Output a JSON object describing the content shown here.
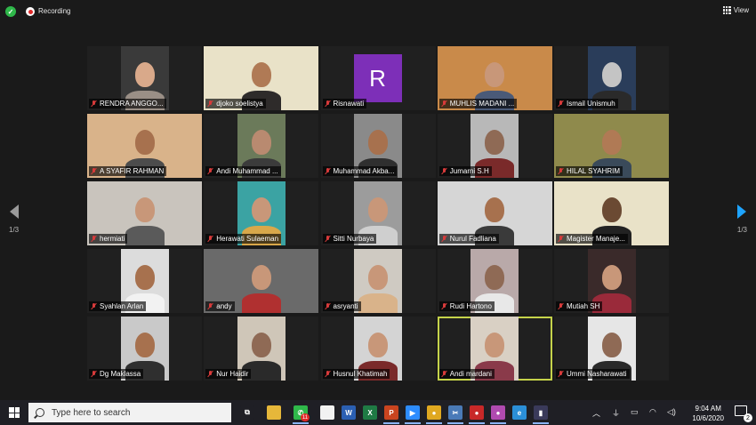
{
  "topbar": {
    "recording_label": "Recording",
    "view_label": "View"
  },
  "nav": {
    "page_left": "1/3",
    "page_right": "1/3"
  },
  "participants": [
    {
      "name": "RENDRA ANGGO...",
      "bg": "#3a3a3a",
      "skin": "#d9a98a",
      "cloth": "#9a8f86",
      "video": "narrow"
    },
    {
      "name": "djoko soelistya",
      "bg": "#e9e2c8",
      "skin": "#b07a55",
      "cloth": "#2e2b2a",
      "video": "wide"
    },
    {
      "name": "Risnawati",
      "bg": "#1b1b1b",
      "video": "avatar",
      "initial": "R"
    },
    {
      "name": "MUHLIS MADANI ...",
      "bg": "#c98a4a",
      "skin": "#c89779",
      "cloth": "#4a5a78",
      "video": "wide"
    },
    {
      "name": "Ismail Unismuh",
      "bg": "#2a3d5a",
      "skin": "#c4c4c4",
      "cloth": "#2a2a2a",
      "video": "narrow"
    },
    {
      "name": "A SYAFIR RAHMAN",
      "bg": "#d9b38a",
      "skin": "#a7714e",
      "cloth": "#4c4c4c",
      "video": "wide"
    },
    {
      "name": "Andi Muhammad ...",
      "bg": "#6b7a5a",
      "skin": "#b98a70",
      "cloth": "#3b3b3b",
      "video": "narrow"
    },
    {
      "name": "Muhammad Akba...",
      "bg": "#8a8a8a",
      "skin": "#a7714e",
      "cloth": "#2f2f2f",
      "video": "narrow"
    },
    {
      "name": "Jumarni S.H",
      "bg": "#b8b8b8",
      "skin": "#8f6a55",
      "cloth": "#7a2a2a",
      "video": "narrow"
    },
    {
      "name": "HILAL SYAHRIM",
      "bg": "#8f8a4c",
      "skin": "#b07a55",
      "cloth": "#3a4a5a",
      "video": "wide"
    },
    {
      "name": "hermiati",
      "bg": "#c9c4bd",
      "skin": "#c89779",
      "cloth": "#5a5a5a",
      "video": "wide"
    },
    {
      "name": "Herawati Sulaeman",
      "bg": "#3ba3a3",
      "skin": "#c89779",
      "cloth": "#d9a84a",
      "video": "narrow"
    },
    {
      "name": "Sitti Nurbaya",
      "bg": "#9c9c9c",
      "skin": "#c89779",
      "cloth": "#cfcfcf",
      "video": "narrow"
    },
    {
      "name": "Nurul Fadliana",
      "bg": "#d6d6d6",
      "skin": "#a7714e",
      "cloth": "#3a3a3a",
      "video": "wide"
    },
    {
      "name": "Magister Manaje...",
      "bg": "#e9e2c8",
      "skin": "#6b4a33",
      "cloth": "#222222",
      "video": "wide"
    },
    {
      "name": "Syahlan Arlan",
      "bg": "#dcdcdc",
      "skin": "#a7714e",
      "cloth": "#f2f2f2",
      "video": "narrow"
    },
    {
      "name": "andy",
      "bg": "#6a6a6a",
      "skin": "#c89779",
      "cloth": "#b03030",
      "video": "wide"
    },
    {
      "name": "asryanti",
      "bg": "#cfcac2",
      "skin": "#c89779",
      "cloth": "#d9b38a",
      "video": "narrow"
    },
    {
      "name": "Rudi Hartono",
      "bg": "#b9a9a9",
      "skin": "#8f6a55",
      "cloth": "#e8e8e8",
      "video": "narrow"
    },
    {
      "name": "Mutiah SH",
      "bg": "#3a2a2a",
      "skin": "#c89779",
      "cloth": "#9a2a3a",
      "video": "narrow"
    },
    {
      "name": "Dg Maklassa",
      "bg": "#c9c9c9",
      "skin": "#a7714e",
      "cloth": "#2f2f2f",
      "video": "narrow"
    },
    {
      "name": "Nur Haidir",
      "bg": "#cfc6b8",
      "skin": "#8f6a55",
      "cloth": "#2a2a2a",
      "video": "narrow"
    },
    {
      "name": "Husnul Khatimah",
      "bg": "#d4d4d4",
      "skin": "#c89779",
      "cloth": "#7a2a2a",
      "video": "narrow"
    },
    {
      "name": "Andi mardani",
      "bg": "#d9d0c4",
      "skin": "#c89779",
      "cloth": "#8a3a4a",
      "video": "narrow",
      "active": true
    },
    {
      "name": "Ummi Nasharawati",
      "bg": "#e6e6e6",
      "skin": "#8f6a55",
      "cloth": "#2a2a2a",
      "video": "narrow"
    }
  ],
  "taskbar": {
    "search_placeholder": "Type here to search",
    "time": "9:04 AM",
    "date": "10/6/2020",
    "notification_count": "2",
    "whatsapp_badge": "11",
    "apps": [
      {
        "name": "task-view-icon",
        "color": "#1f1f25",
        "glyph": "⧉"
      },
      {
        "name": "file-explorer-icon",
        "color": "#e6b73a",
        "glyph": ""
      },
      {
        "name": "whatsapp-icon",
        "color": "#2fb84a",
        "glyph": "✆"
      },
      {
        "name": "notepad-icon",
        "color": "#f2f2f2",
        "glyph": ""
      },
      {
        "name": "word-icon",
        "color": "#2b5fb3",
        "glyph": "W"
      },
      {
        "name": "excel-icon",
        "color": "#1f7a44",
        "glyph": "X"
      },
      {
        "name": "powerpoint-icon",
        "color": "#c9441f",
        "glyph": "P"
      },
      {
        "name": "zoom-icon",
        "color": "#2d8cff",
        "glyph": "▶"
      },
      {
        "name": "chrome-icon",
        "color": "#e0a820",
        "glyph": "●"
      },
      {
        "name": "snip-icon",
        "color": "#4a7ab8",
        "glyph": "✂"
      },
      {
        "name": "record-icon",
        "color": "#c82828",
        "glyph": "●"
      },
      {
        "name": "chrome-profile-icon",
        "color": "#b04ab0",
        "glyph": "●"
      },
      {
        "name": "edge-icon",
        "color": "#2b8fd8",
        "glyph": "e"
      },
      {
        "name": "app-icon",
        "color": "#3a3a5a",
        "glyph": "▮"
      }
    ]
  }
}
